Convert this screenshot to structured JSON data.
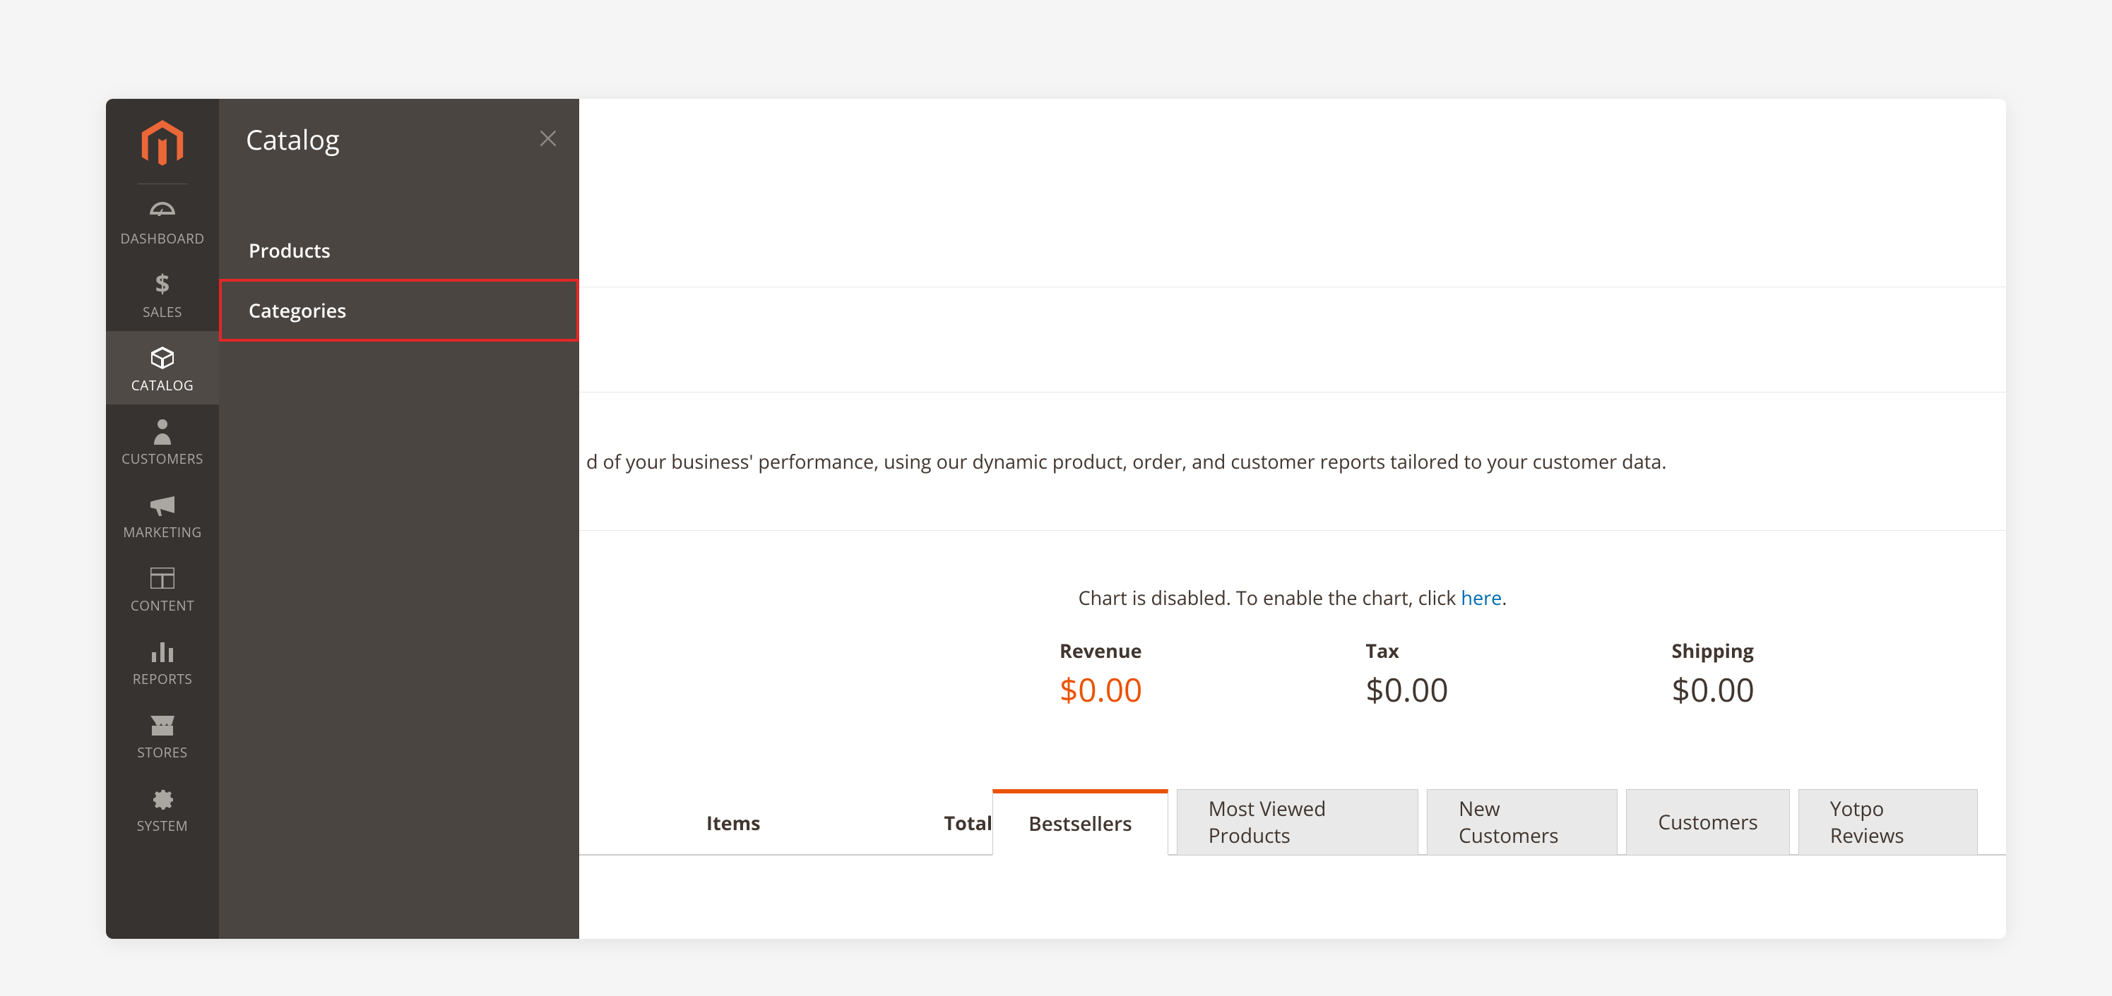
{
  "sidebar": {
    "items": [
      {
        "id": "dashboard",
        "label": "DASHBOARD"
      },
      {
        "id": "sales",
        "label": "SALES"
      },
      {
        "id": "catalog",
        "label": "CATALOG"
      },
      {
        "id": "customers",
        "label": "CUSTOMERS"
      },
      {
        "id": "marketing",
        "label": "MARKETING"
      },
      {
        "id": "content",
        "label": "CONTENT"
      },
      {
        "id": "reports",
        "label": "REPORTS"
      },
      {
        "id": "stores",
        "label": "STORES"
      },
      {
        "id": "system",
        "label": "SYSTEM"
      }
    ]
  },
  "flyout": {
    "title": "Catalog",
    "items": [
      {
        "label": "Products"
      },
      {
        "label": "Categories"
      }
    ]
  },
  "main": {
    "description_fragment": "d of your business' performance, using our dynamic product, order, and customer reports tailored to your customer data.",
    "chart_notice_prefix": "Chart is disabled. To enable the chart, click ",
    "chart_notice_link": "here",
    "chart_notice_suffix": ".",
    "metrics": [
      {
        "label": "Revenue",
        "value": "$0.00"
      },
      {
        "label": "Tax",
        "value": "$0.00"
      },
      {
        "label": "Shipping",
        "value": "$0.00"
      }
    ],
    "lower_cols": {
      "items": "Items",
      "total": "Total"
    },
    "tabs": [
      {
        "label": "Bestsellers"
      },
      {
        "label": "Most Viewed Products"
      },
      {
        "label": "New Customers"
      },
      {
        "label": "Customers"
      },
      {
        "label": "Yotpo Reviews"
      }
    ]
  }
}
